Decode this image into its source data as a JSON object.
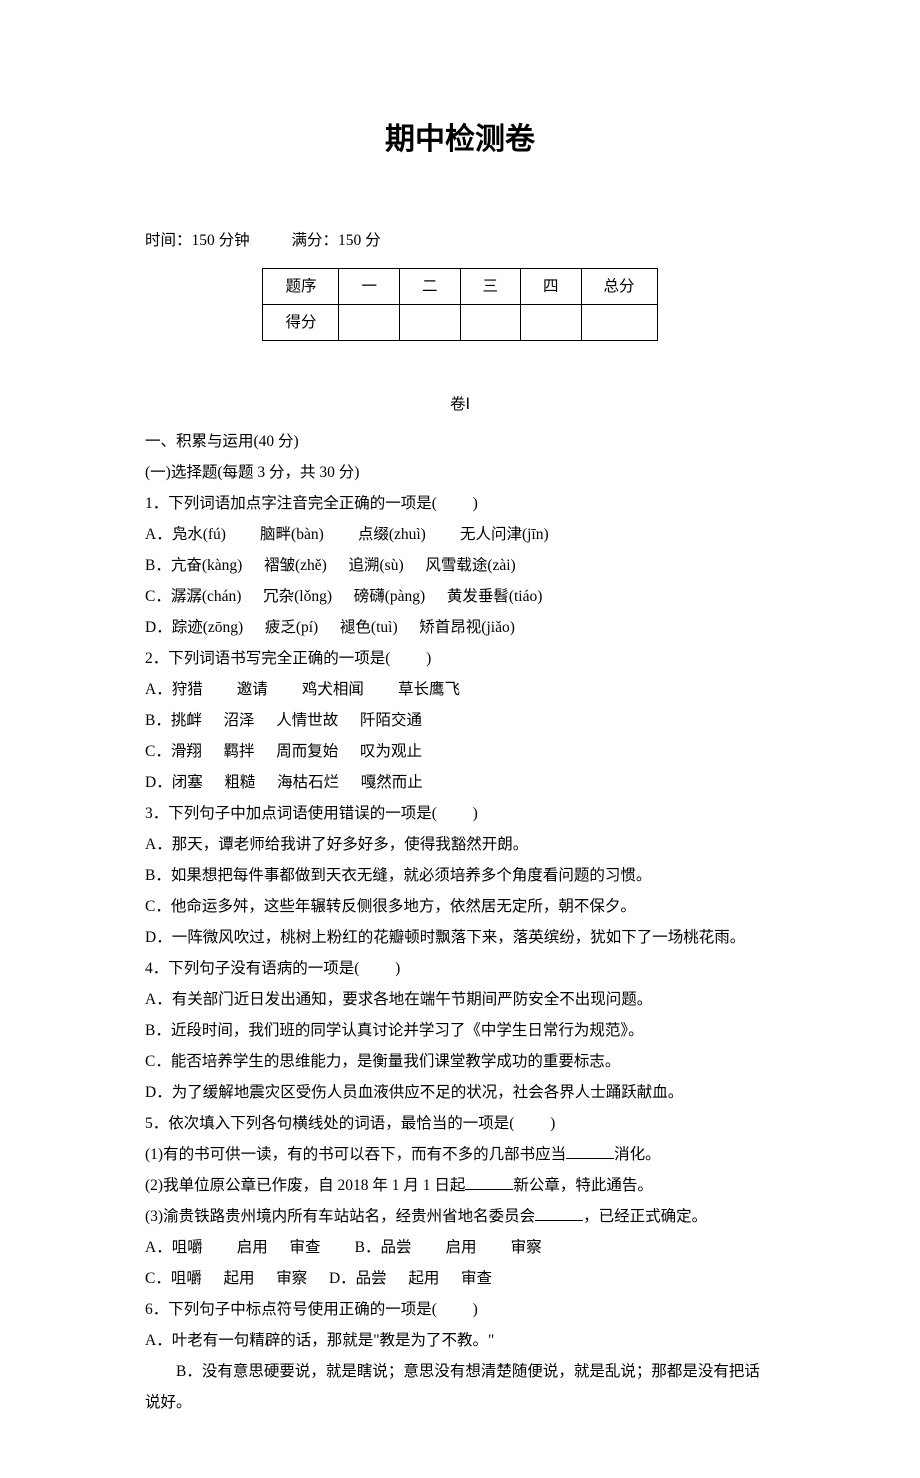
{
  "title": "期中检测卷",
  "meta": {
    "time": "时间：150 分钟",
    "full": "满分：150 分"
  },
  "scoreTable": {
    "header": [
      "题序",
      "一",
      "二",
      "三",
      "四",
      "总分"
    ],
    "rowLabel": "得分"
  },
  "juan": "卷Ⅰ",
  "section1": "一、积累与运用(40 分)",
  "section1a": "(一)选择题(每题 3 分，共 30 分)",
  "q1": {
    "stem": "1．下列词语加点字注音完全正确的一项是(",
    "close": ")",
    "A": "A．凫水(fú)",
    "A2": "脑畔(bàn)",
    "A3": "点缀(zhuì)",
    "A4": "无人问津(jīn)",
    "B": "B．亢奋(kàng)",
    "B2": "褶皱(zhě)",
    "B3": "追溯(sù)",
    "B4": "风雪载途(zài)",
    "C": "C．潺潺(chán)",
    "C2": "冗杂(lǒng)",
    "C3": "磅礴(pàng)",
    "C4": "黄发垂髫(tiáo)",
    "D": "D．踪迹(zōng)",
    "D2": "疲乏(pí)",
    "D3": "褪色(tuì)",
    "D4": "矫首昂视(jiǎo)"
  },
  "q2": {
    "stem": "2．下列词语书写完全正确的一项是(",
    "close": ")",
    "A": "A．狩猎",
    "A2": "邀请",
    "A3": "鸡犬相闻",
    "A4": "草长鹰飞",
    "B": "B．挑衅",
    "B2": "沼泽",
    "B3": "人情世故",
    "B4": "阡陌交通",
    "C": "C．滑翔",
    "C2": "羁拌",
    "C3": "周而复始",
    "C4": "叹为观止",
    "D": "D．闭塞",
    "D2": "粗糙",
    "D3": "海枯石烂",
    "D4": "嘎然而止"
  },
  "q3": {
    "stem": "3．下列句子中加点词语使用错误的一项是(",
    "close": ")",
    "A": "A．那天，谭老师给我讲了好多好多，使得我豁然开朗。",
    "B": "B．如果想把每件事都做到天衣无缝，就必须培养多个角度看问题的习惯。",
    "C": "C．他命运多舛，这些年辗转反侧很多地方，依然居无定所，朝不保夕。",
    "D": "D．一阵微风吹过，桃树上粉红的花瓣顿时飘落下来，落英缤纷，犹如下了一场桃花雨。"
  },
  "q4": {
    "stem": "4．下列句子没有语病的一项是(",
    "close": ")",
    "A": "A．有关部门近日发出通知，要求各地在端午节期间严防安全不出现问题。",
    "B": "B．近段时间，我们班的同学认真讨论并学习了《中学生日常行为规范》。",
    "C": "C．能否培养学生的思维能力，是衡量我们课堂教学成功的重要标志。",
    "D": "D．为了缓解地震灾区受伤人员血液供应不足的状况，社会各界人士踊跃献血。"
  },
  "q5": {
    "stem": "5．依次填入下列各句横线处的词语，最恰当的一项是(",
    "close": ")",
    "s1a": "(1)有的书可供一读，有的书可以吞下，而有不多的几部书应当",
    "s1b": "消化。",
    "s2a": "(2)我单位原公章已作废，自 2018 年 1 月 1 日起",
    "s2b": "新公章，特此通告。",
    "s3a": "(3)渝贵铁路贵州境内所有车站站名，经贵州省地名委员会",
    "s3b": "，已经正式确定。",
    "A": "A．咀嚼",
    "A2": "启用",
    "A3": "审查",
    "Bp": "B．品尝",
    "B2": "启用",
    "B3": "审察",
    "C": "C．咀嚼",
    "C2": "起用",
    "C3": "审察",
    "Dp": "D．品尝",
    "D2": "起用",
    "D3": "审查"
  },
  "q6": {
    "stem": "6．下列句子中标点符号使用正确的一项是(",
    "close": ")",
    "A": "A．叶老有一句精辟的话，那就是\"教是为了不教。\"",
    "B": "B．没有意思硬要说，就是瞎说；意思没有想清楚随便说，就是乱说；那都是没有把话说好。"
  }
}
